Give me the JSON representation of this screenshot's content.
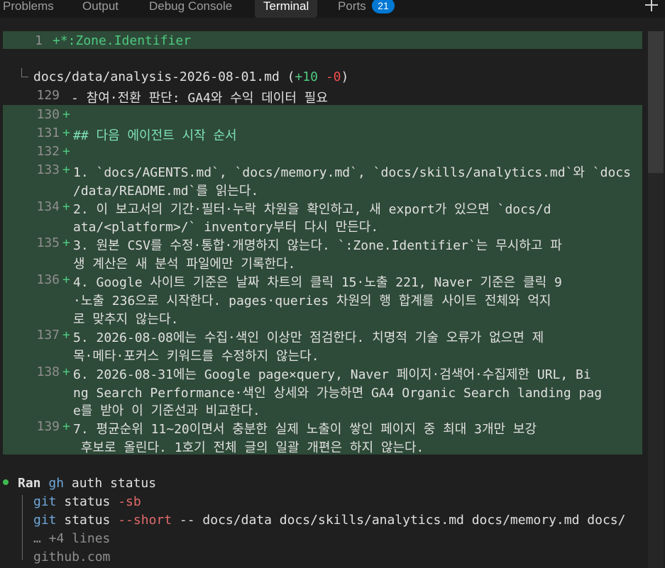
{
  "tabs": {
    "problems": "Problems",
    "output": "Output",
    "debug_console": "Debug Console",
    "terminal": "Terminal",
    "ports": "Ports",
    "ports_count": "21"
  },
  "diff1": {
    "line_no": "1",
    "text": "+*:Zone.Identifier"
  },
  "file_header": {
    "path": "docs/data/analysis-2026-08-01.md",
    "open": " (",
    "added": "+10",
    "removed": "-0",
    "close": ")"
  },
  "context_line": {
    "num": "129",
    "text": " - 참여·전환 판단: GA4와 수익 데이터 필요"
  },
  "diff_lines": [
    {
      "num": "130",
      "plus": "+",
      "rows": [
        ""
      ]
    },
    {
      "num": "131",
      "plus": "+",
      "rows": [
        "## 다음 에이전트 시작 순서"
      ]
    },
    {
      "num": "132",
      "plus": "+",
      "rows": [
        ""
      ]
    },
    {
      "num": "133",
      "plus": "+",
      "rows": [
        "1. `docs/AGENTS.md`, `docs/memory.md`, `docs/skills/analytics.md`와 `docs",
        "/data/README.md`를 읽는다."
      ]
    },
    {
      "num": "134",
      "plus": "+",
      "rows": [
        "2. 이 보고서의 기간·필터·누락 차원을 확인하고, 새 export가 있으면 `docs/d",
        "ata/<platform>/` inventory부터 다시 만든다."
      ]
    },
    {
      "num": "135",
      "plus": "+",
      "rows": [
        "3. 원본 CSV를 수정·통합·개명하지 않는다. `:Zone.Identifier`는 무시하고 파",
        "생 계산은 새 분석 파일에만 기록한다."
      ]
    },
    {
      "num": "136",
      "plus": "+",
      "rows": [
        "4. Google 사이트 기준은 날짜 차트의 클릭 15·노출 221, Naver 기준은 클릭 9",
        "·노출 236으로 시작한다. pages·queries 차원의 행 합계를 사이트 전체와 억지",
        "로 맞추지 않는다."
      ]
    },
    {
      "num": "137",
      "plus": "+",
      "rows": [
        "5. 2026-08-08에는 수집·색인 이상만 점검한다. 치명적 기술 오류가 없으면 제",
        "목·메타·포커스 키워드를 수정하지 않는다."
      ]
    },
    {
      "num": "138",
      "plus": "+",
      "rows": [
        "6. 2026-08-31에는 Google page×query, Naver 페이지·검색어·수집제한 URL, Bi",
        "ng Search Performance·색인 상세와 가능하면 GA4 Organic Search landing pag",
        "e를 받아 이 기준선과 비교한다."
      ]
    },
    {
      "num": "139",
      "plus": "+",
      "rows": [
        "7. 평균순위 11~20이면서 충분한 실제 노출이 쌓인 페이지 중 최대 3개만 보강",
        " 후보로 올린다. 1호기 전체 글의 일괄 개편은 하지 않는다."
      ]
    }
  ],
  "ran": {
    "label": "Ran",
    "cmd_kw": "gh",
    "cmd_rest": " auth status"
  },
  "commands": {
    "c1_kw": "git",
    "c1_rest": " status ",
    "c1_flag": "-sb",
    "c2_kw": "git",
    "c2_rest1": " status ",
    "c2_flag": "--short",
    "c2_rest2": " -- docs/data docs/skills/analytics.md docs/memory.md docs/",
    "more": "… +4 lines",
    "last": "github.com"
  },
  "colors": {
    "added_bg": "#2e4a38",
    "accent_green": "#4ec980",
    "badge_blue": "#0078d4"
  }
}
